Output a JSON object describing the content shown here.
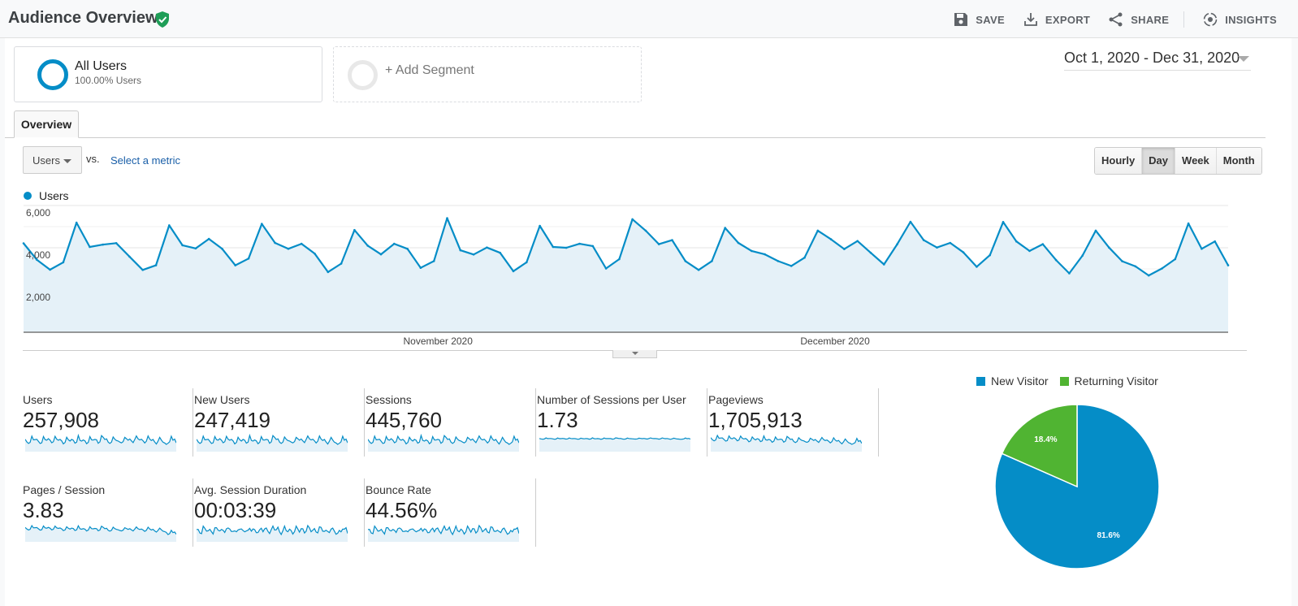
{
  "header": {
    "title": "Audience Overview",
    "actions": [
      {
        "label": "SAVE",
        "icon": "save-icon"
      },
      {
        "label": "EXPORT",
        "icon": "export-icon"
      },
      {
        "label": "SHARE",
        "icon": "share-icon"
      },
      {
        "label": "INSIGHTS",
        "icon": "insights-icon"
      }
    ]
  },
  "segments": {
    "active": {
      "name": "All Users",
      "sub": "100.00% Users"
    },
    "add_label": "+ Add Segment"
  },
  "date_range": "Oct 1, 2020 - Dec 31, 2020",
  "tabs": [
    {
      "label": "Overview",
      "active": true
    }
  ],
  "metric_picker": {
    "selected": "Users",
    "vs_label": "vs.",
    "select_metric_label": "Select a metric"
  },
  "granularity": {
    "options": [
      "Hourly",
      "Day",
      "Week",
      "Month"
    ],
    "selected": "Day"
  },
  "colors": {
    "primary": "#058dc7",
    "secondary": "#50b432",
    "fill": "#e5f1f8"
  },
  "chart_data": [
    {
      "type": "area",
      "title": "Users",
      "legend": [
        "Users"
      ],
      "legend_position": "top-left",
      "x_start": "Oct 1, 2020",
      "x_end": "Dec 31, 2020",
      "x_tick_labels": [
        {
          "label": "November 2020",
          "index": 31
        },
        {
          "label": "December 2020",
          "index": 61
        }
      ],
      "y_tick_labels": [
        "2,000",
        "4,000",
        "6,000"
      ],
      "ylim": [
        0,
        6000
      ],
      "grid": true,
      "series": [
        {
          "name": "Users",
          "values": [
            4210,
            3435,
            2960,
            3310,
            5190,
            4040,
            4150,
            4220,
            3580,
            2950,
            3170,
            5060,
            4120,
            3970,
            4420,
            3950,
            3170,
            3490,
            5130,
            4230,
            3950,
            4190,
            3720,
            2850,
            3250,
            4840,
            4100,
            3690,
            4190,
            3950,
            3050,
            3370,
            5400,
            3880,
            3680,
            4010,
            3760,
            2890,
            3310,
            5040,
            4040,
            4000,
            4190,
            4080,
            3020,
            3460,
            5350,
            4810,
            4170,
            4360,
            3370,
            2950,
            3370,
            4940,
            4230,
            3850,
            3690,
            3370,
            3140,
            3530,
            4810,
            4400,
            3940,
            4320,
            3760,
            3210,
            4170,
            5230,
            4360,
            4010,
            4230,
            3780,
            3100,
            3650,
            5220,
            4300,
            3850,
            4170,
            3420,
            2790,
            3630,
            4810,
            4010,
            3360,
            3120,
            2690,
            3020,
            3460,
            5150,
            3950,
            4300,
            3170
          ]
        }
      ]
    },
    {
      "type": "pie",
      "legend": [
        "New Visitor",
        "Returning Visitor"
      ],
      "legend_position": "top",
      "slices": [
        {
          "label": "New Visitor",
          "value": 81.6,
          "display": "81.6%",
          "color": "#058dc7"
        },
        {
          "label": "Returning Visitor",
          "value": 18.4,
          "display": "18.4%",
          "color": "#50b432"
        }
      ]
    }
  ],
  "metrics": [
    {
      "label": "Users",
      "value": "257,908",
      "trend": "spiky"
    },
    {
      "label": "New Users",
      "value": "247,419",
      "trend": "spiky"
    },
    {
      "label": "Sessions",
      "value": "445,760",
      "trend": "spiky"
    },
    {
      "label": "Number of Sessions per User",
      "value": "1.73",
      "trend": "flat"
    },
    {
      "label": "Pageviews",
      "value": "1,705,913",
      "trend": "declining"
    },
    {
      "label": "Pages / Session",
      "value": "3.83",
      "trend": "slight-decline"
    },
    {
      "label": "Avg. Session Duration",
      "value": "00:03:39",
      "trend": "wavy"
    },
    {
      "label": "Bounce Rate",
      "value": "44.56%",
      "trend": "wavy"
    }
  ]
}
